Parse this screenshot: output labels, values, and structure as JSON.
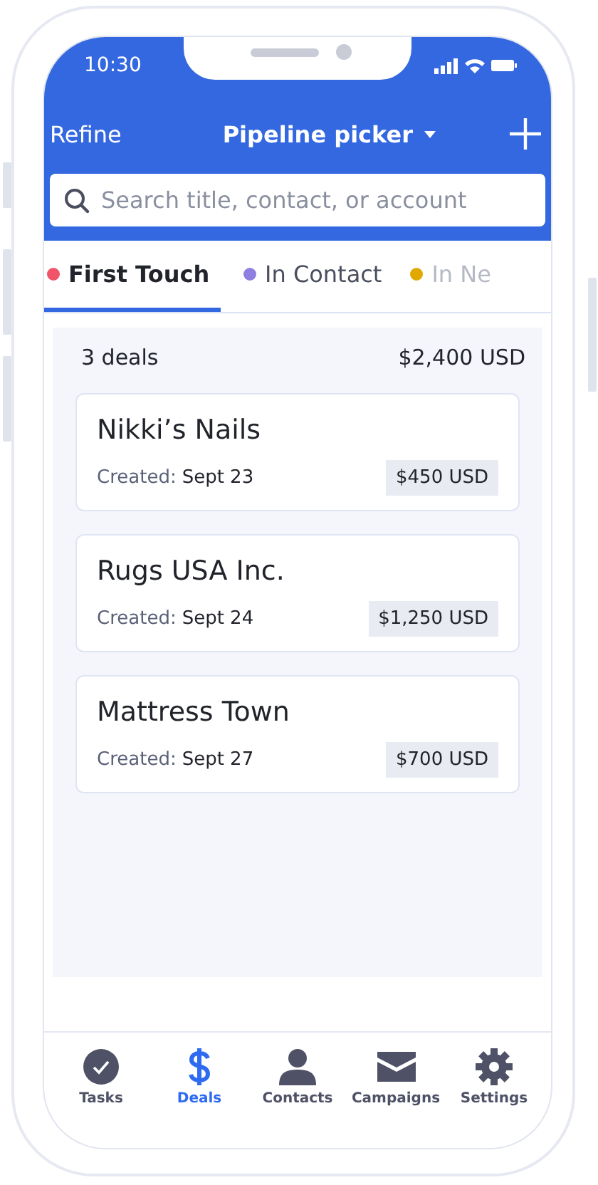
{
  "status_bar": {
    "time": "10:30"
  },
  "header": {
    "left_action": "Refine",
    "title": "Pipeline picker"
  },
  "search": {
    "placeholder": "Search title, contact, or account"
  },
  "tabs": [
    {
      "label": "First Touch",
      "color": "#ef5468",
      "selected": true
    },
    {
      "label": "In Contact",
      "color": "#8f7fe0",
      "selected": false
    },
    {
      "label": "In Ne",
      "color": "#e0a800",
      "selected": false
    }
  ],
  "summary": {
    "count": "3 deals",
    "total": "$2,400 USD"
  },
  "deals": [
    {
      "name": "Nikki’s Nails",
      "created_label": "Created:",
      "date": "Sept 23",
      "amount": "$450 USD"
    },
    {
      "name": "Rugs USA Inc.",
      "created_label": "Created:",
      "date": "Sept 24",
      "amount": "$1,250 USD"
    },
    {
      "name": "Mattress Town",
      "created_label": "Created:",
      "date": "Sept 27",
      "amount": "$700 USD"
    }
  ],
  "nav": [
    {
      "kind": "tasks",
      "label": "Tasks",
      "selected": false
    },
    {
      "kind": "deals",
      "label": "Deals",
      "selected": true
    },
    {
      "kind": "contacts",
      "label": "Contacts",
      "selected": false
    },
    {
      "kind": "campaigns",
      "label": "Campaigns",
      "selected": false
    },
    {
      "kind": "settings",
      "label": "Settings",
      "selected": false
    }
  ]
}
